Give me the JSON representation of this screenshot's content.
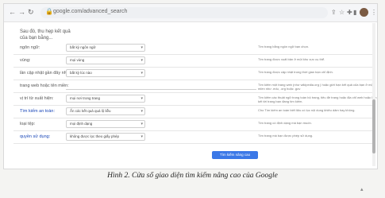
{
  "browser": {
    "back_icon": "back-arrow-icon",
    "forward_icon": "forward-arrow-icon",
    "reload_icon": "reload-icon",
    "url": "google.com/advanced_search",
    "toolbar_icons": [
      "share-icon",
      "star-icon",
      "extension-icon",
      "bookmark-icon",
      "sidebar-icon"
    ],
    "menu_icon": "more-vertical-icon"
  },
  "page": {
    "intro": "Sau đó, thu hẹp kết quả của bạn bằng...",
    "rows": [
      {
        "label": "ngôn ngữ:",
        "type": "dropdown",
        "value": "bất kỳ ngôn ngữ",
        "help": "Tìm trang bằng ngôn ngữ bạn chọn.",
        "label_blue": false
      },
      {
        "label": "vùng:",
        "type": "dropdown",
        "value": "mọi vùng",
        "help": "Tìm trang được xuất bản ở một khu vực cụ thể.",
        "label_blue": false
      },
      {
        "label": "lần cập nhật gần đây nhất:",
        "type": "dropdown",
        "value": "bất kỳ lúc nào",
        "help": "Tìm trang được cập nhật trong thời gian bạn chỉ định.",
        "label_blue": false
      },
      {
        "label": "trang web hoặc tên miền:",
        "type": "input",
        "value": "",
        "help": "Tìm kiếm một trang web (như wikipedia.org ) hoặc giới hạn kết quả của bạn ở một miền như .edu, .org hoặc .gov",
        "label_blue": false
      },
      {
        "label": "vị trí từ xuất hiện:",
        "type": "dropdown",
        "value": "mọi nơi trong trang",
        "help": "Tìm kiếm các thuật ngữ trong toàn bộ trang, tiêu đề trang hoặc địa chỉ web hoặc liên kết tới trang bạn đang tìm kiếm.",
        "label_blue": false
      },
      {
        "label": "Tìm kiếm an toàn:",
        "type": "dropdown",
        "value": "Ẩn các kết quả quá lộ liễu",
        "help": "Cho Tìm kiếm an toàn biết liệu có lọc nội dung khiêu dâm hay không.",
        "label_blue": true
      },
      {
        "label": "loại tệp:",
        "type": "dropdown",
        "value": "mọi định dạng",
        "help": "Tìm trang có định dạng mà bạn muốn.",
        "label_blue": false
      },
      {
        "label": "quyền sử dụng:",
        "type": "dropdown",
        "value": "không được lọc theo giấy phép",
        "help": "Tìm trang mà bạn được phép sử dụng.",
        "label_blue": true
      }
    ],
    "submit_label": "Tìm kiếm nâng cao"
  },
  "caption": "Hình 2. Cửa sổ giao diện tìm kiếm nâng cao của Google",
  "colors": {
    "accent": "#3b78e7",
    "link": "#1a47b8"
  }
}
